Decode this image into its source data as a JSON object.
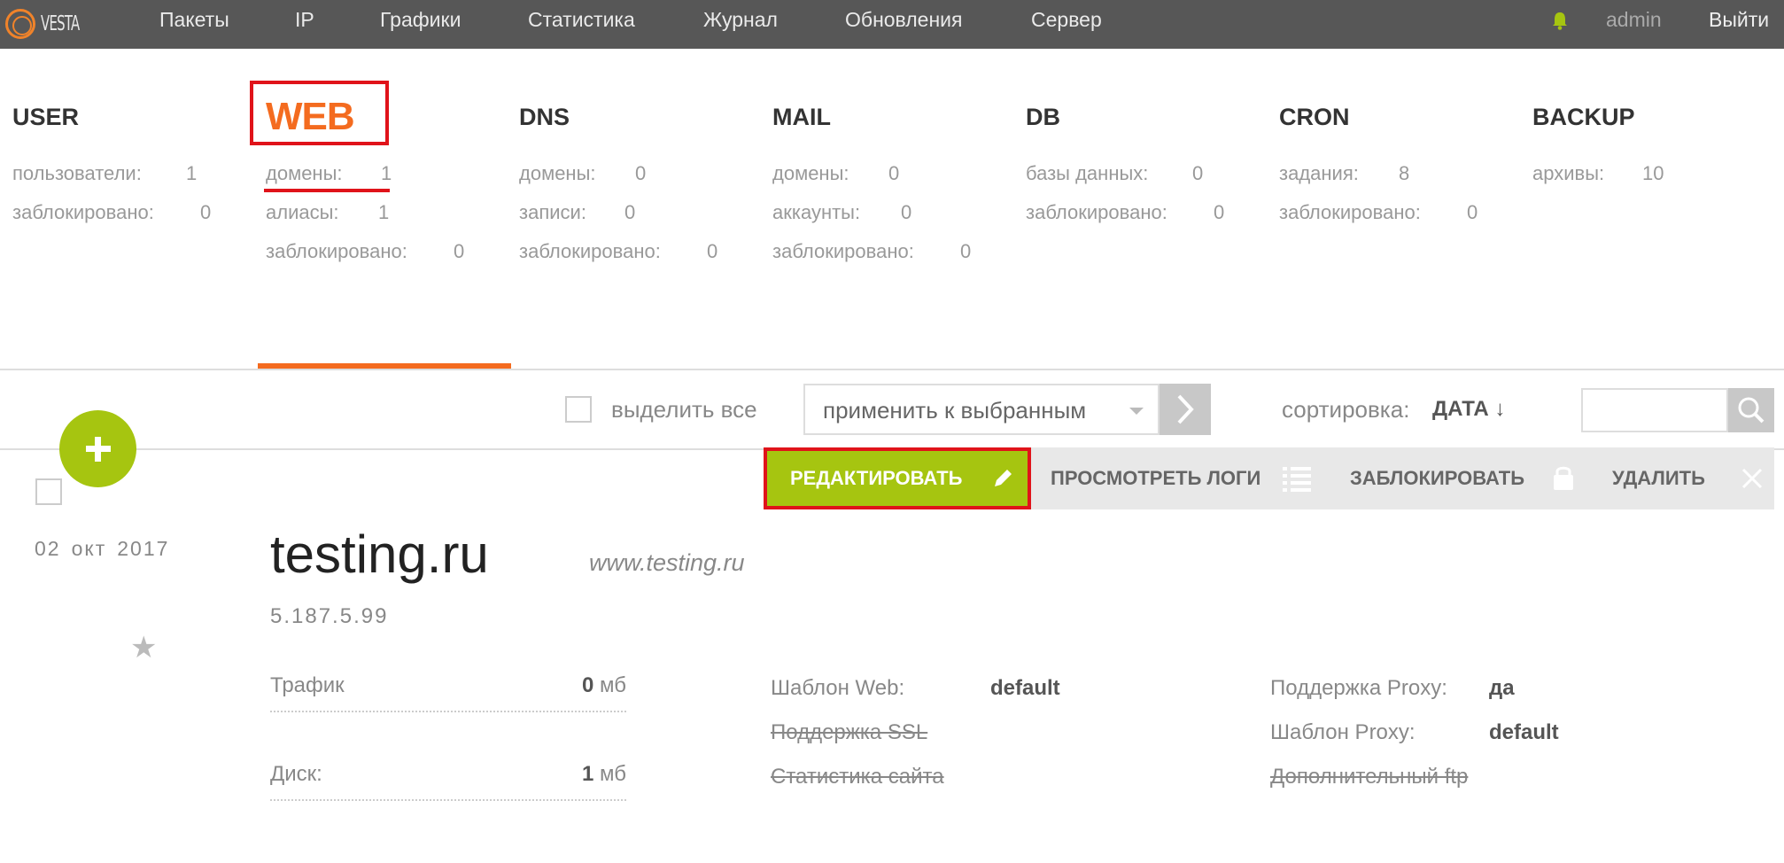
{
  "topbar": {
    "logo_text": "VESTA",
    "nav": [
      "Пакеты",
      "IP",
      "Графики",
      "Статистика",
      "Журнал",
      "Обновления",
      "Сервер"
    ],
    "user": "admin",
    "logout": "Выйти"
  },
  "tabs": [
    {
      "title": "USER",
      "rows": [
        {
          "label": "пользователи:",
          "value": "1"
        },
        {
          "label": "заблокировано:",
          "value": "0"
        }
      ]
    },
    {
      "title": "WEB",
      "rows": [
        {
          "label": "домены:",
          "value": "1"
        },
        {
          "label": "алиасы:",
          "value": "1"
        },
        {
          "label": "заблокировано:",
          "value": "0"
        }
      ]
    },
    {
      "title": "DNS",
      "rows": [
        {
          "label": "домены:",
          "value": "0"
        },
        {
          "label": "записи:",
          "value": "0"
        },
        {
          "label": "заблокировано:",
          "value": "0"
        }
      ]
    },
    {
      "title": "MAIL",
      "rows": [
        {
          "label": "домены:",
          "value": "0"
        },
        {
          "label": "аккаунты:",
          "value": "0"
        },
        {
          "label": "заблокировано:",
          "value": "0"
        }
      ]
    },
    {
      "title": "DB",
      "rows": [
        {
          "label": "базы данных:",
          "value": "0"
        },
        {
          "label": "заблокировано:",
          "value": "0"
        }
      ]
    },
    {
      "title": "CRON",
      "rows": [
        {
          "label": "задания:",
          "value": "8"
        },
        {
          "label": "заблокировано:",
          "value": "0"
        }
      ]
    },
    {
      "title": "BACKUP",
      "rows": [
        {
          "label": "архивы:",
          "value": "10"
        }
      ]
    }
  ],
  "toolbar": {
    "select_all": "выделить все",
    "apply_selected": "применить к выбранным",
    "sort_label": "сортировка:",
    "sort_value": "ДАТА ↓"
  },
  "actions": {
    "edit": "РЕДАКТИРОВАТЬ",
    "view_logs": "ПРОСМОТРЕТЬ ЛОГИ",
    "block": "ЗАБЛОКИРОВАТЬ",
    "delete": "УДАЛИТЬ"
  },
  "record": {
    "date": {
      "day": "02",
      "month": "окт",
      "year": "2017"
    },
    "domain": "testing.ru",
    "alias": "www.testing.ru",
    "ip": "5.187.5.99",
    "traffic": {
      "label": "Трафик",
      "value": "0",
      "unit": "мб"
    },
    "disk": {
      "label": "Диск:",
      "value": "1",
      "unit": "мб"
    },
    "web_template": {
      "label": "Шаблон Web:",
      "value": "default"
    },
    "ssl_support": "Поддержка SSL",
    "site_stats": "Статистика сайта",
    "proxy_support": {
      "label": "Поддержка Proxy:",
      "value": "да"
    },
    "proxy_template": {
      "label": "Шаблон Proxy:",
      "value": "default"
    },
    "extra_ftp": "Дополнительный ftp"
  }
}
